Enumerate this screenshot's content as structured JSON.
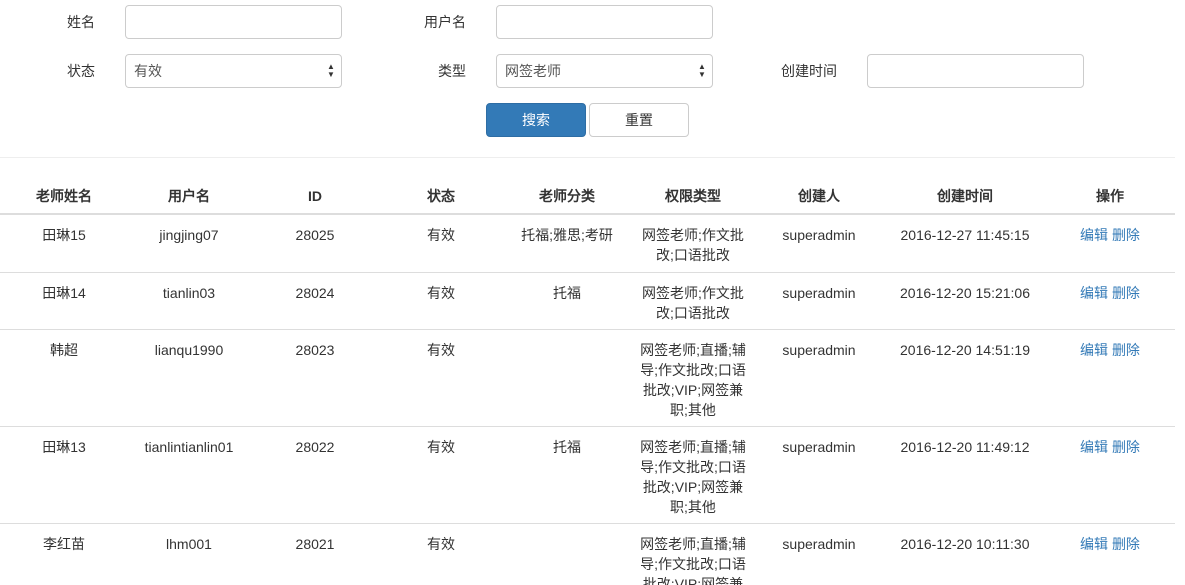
{
  "filters": {
    "name_label": "姓名",
    "name_value": "",
    "username_label": "用户名",
    "username_value": "",
    "status_label": "状态",
    "status_selected": "有效",
    "type_label": "类型",
    "type_selected": "网签老师",
    "created_label": "创建时间",
    "created_value": "",
    "search_button": "搜索",
    "reset_button": "重置"
  },
  "table": {
    "columns": [
      "老师姓名",
      "用户名",
      "ID",
      "状态",
      "老师分类",
      "权限类型",
      "创建人",
      "创建时间",
      "操作"
    ],
    "rows": [
      {
        "name": "田琳15",
        "username": "jingjing07",
        "id": "28025",
        "status": "有效",
        "category": "托福;雅思;考研",
        "perm": [
          "网签老师;作文批",
          "改;口语批改"
        ],
        "creator": "superadmin",
        "created": "2016-12-27 11:45:15",
        "edit": "编辑",
        "delete": "删除"
      },
      {
        "name": "田琳14",
        "username": "tianlin03",
        "id": "28024",
        "status": "有效",
        "category": "托福",
        "perm": [
          "网签老师;作文批",
          "改;口语批改"
        ],
        "creator": "superadmin",
        "created": "2016-12-20 15:21:06",
        "edit": "编辑",
        "delete": "删除"
      },
      {
        "name": "韩超",
        "username": "lianqu1990",
        "id": "28023",
        "status": "有效",
        "category": "",
        "perm": [
          "网签老师;直播;辅",
          "导;作文批改;口语",
          "批改;VIP;网签兼",
          "职;其他"
        ],
        "creator": "superadmin",
        "created": "2016-12-20 14:51:19",
        "edit": "编辑",
        "delete": "删除"
      },
      {
        "name": "田琳13",
        "username": "tianlintianlin01",
        "id": "28022",
        "status": "有效",
        "category": "托福",
        "perm": [
          "网签老师;直播;辅",
          "导;作文批改;口语",
          "批改;VIP;网签兼",
          "职;其他"
        ],
        "creator": "superadmin",
        "created": "2016-12-20 11:49:12",
        "edit": "编辑",
        "delete": "删除"
      },
      {
        "name": "李红苗",
        "username": "lhm001",
        "id": "28021",
        "status": "有效",
        "category": "",
        "perm": [
          "网签老师;直播;辅",
          "导;作文批改;口语",
          "批改;VIP;网签兼"
        ],
        "creator": "superadmin",
        "created": "2016-12-20 10:11:30",
        "edit": "编辑",
        "delete": "删除"
      }
    ]
  }
}
